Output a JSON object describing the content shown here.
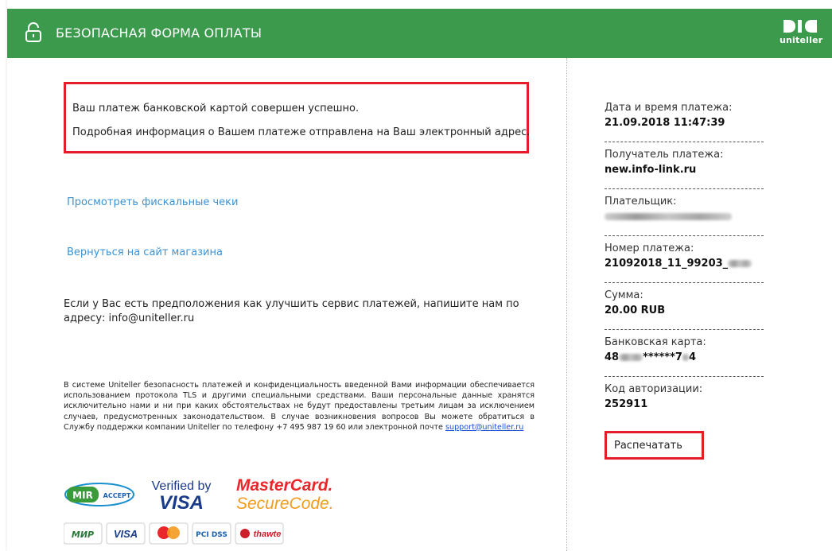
{
  "header": {
    "title": "БЕЗОПАСНАЯ ФОРМА ОПЛАТЫ",
    "lock_icon": "lock-open-icon",
    "logo_text": "uniteller",
    "color": "#3c9a4d"
  },
  "status": {
    "line1": "Ваш платеж банковской картой совершен успешно.",
    "line2": "Подробная информация о Вашем платеже отправлена на Ваш электронный адрес."
  },
  "links": {
    "receipts": "Просмотреть фискальные чеки",
    "back": "Вернуться на сайт магазина"
  },
  "suggest": "Если у Вас есть предположения как улучшить сервис платежей, напишите нам по адресу: info@uniteller.ru",
  "security": {
    "text": "В системе Uniteller безопасность платежей и конфиденциальность введенной Вами информации обеспечивается использованием протокола TLS и другими специальными средствами. Ваши персональные данные хранятся исключительно нами и ни при каких обстоятельствах не будут предоставлены третьим лицам за исключением случаев, предусмотренных законодательством. В случае возникновения вопросов Вы можете обратиться в Службу поддержки компании Uniteller по телефону +7 495 987 19 60 или электронной почте",
    "email": "support@uniteller.ru"
  },
  "badges": {
    "mir_accept": "MIR ACCEPT",
    "verified_by": "Verified by",
    "visa": "VISA",
    "mastercard": "MasterCard.",
    "securecode": "SecureCode.",
    "mir": "МИР",
    "pci": "PCI DSS",
    "thawte": "thawte"
  },
  "details": {
    "date_label": "Дата и время платежа:",
    "date_value": "21.09.2018 11:47:39",
    "recipient_label": "Получатель платежа:",
    "recipient_value": "new.info-link.ru",
    "payer_label": "Плательщик:",
    "number_label": "Номер платежа:",
    "number_value": "21092018_11_99203_",
    "sum_label": "Сумма:",
    "sum_value": "20.00 RUB",
    "card_label": "Банковская карта:",
    "card_prefix": "48",
    "card_mid": "******7",
    "card_suffix": "4",
    "auth_label": "Код авторизации:",
    "auth_value": "252911"
  },
  "print_label": "Распечатать",
  "accent_red": "#e41e26",
  "link_color": "#3a93d6"
}
